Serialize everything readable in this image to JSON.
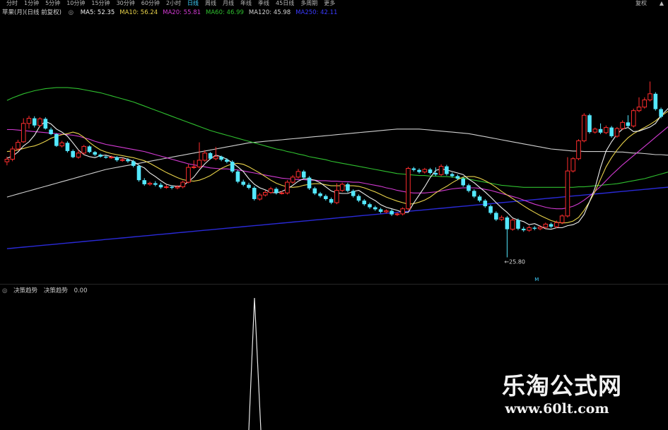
{
  "toolbar": {
    "items": [
      "分时",
      "1分钟",
      "5分钟",
      "10分钟",
      "15分钟",
      "30分钟",
      "60分钟",
      "2小时",
      "日线",
      "周线",
      "月线",
      "年线",
      "季线",
      "45日线",
      "多周期",
      "更多"
    ],
    "active_index": 8,
    "right_labels": [
      "复权",
      "▲"
    ]
  },
  "ma_legend": {
    "title": "苹果(月)(日线 前复权)",
    "items": [
      {
        "text": "MA5: 52.35",
        "color": "#f0f0f0"
      },
      {
        "text": "MA10: 56.24",
        "color": "#e8d24a"
      },
      {
        "text": "MA20: 55.81",
        "color": "#d23ad2"
      },
      {
        "text": "MA60: 46.99",
        "color": "#2fbf2f"
      },
      {
        "text": "MA120: 45.98",
        "color": "#d0d0d0"
      },
      {
        "text": "MA250: 42.11",
        "color": "#3a3aff"
      }
    ]
  },
  "indicator_legend": {
    "name": "决策趋势",
    "series": "决策趋势",
    "value": "0.00"
  },
  "chart_data": {
    "type": "candlestick",
    "y_range": [
      22,
      72
    ],
    "low_label": "←25.80",
    "date_marker": "M",
    "colors": {
      "up": "#ff2d2d",
      "down": "#54e8ff",
      "ma5": "#f0f0f0",
      "ma10": "#e8d24a",
      "ma20": "#d23ad2",
      "ma60": "#2fbf2f",
      "ma120": "#d0d0d0",
      "ma250": "#2a2ad8"
    },
    "candles": [
      [
        44.5,
        45.0,
        43.8,
        45.5
      ],
      [
        45.0,
        47.0,
        44.6,
        47.5
      ],
      [
        47.0,
        48.3,
        46.7,
        48.8
      ],
      [
        48.4,
        52.0,
        48.2,
        53.0
      ],
      [
        52.0,
        53.0,
        51.0,
        53.5
      ],
      [
        53.0,
        51.6,
        51.2,
        53.4
      ],
      [
        51.6,
        52.9,
        51.3,
        53.2
      ],
      [
        52.9,
        51.0,
        50.8,
        53.2
      ],
      [
        50.8,
        49.9,
        49.7,
        51.2
      ],
      [
        49.9,
        47.6,
        47.4,
        50.1
      ],
      [
        47.6,
        48.2,
        47.3,
        48.6
      ],
      [
        48.2,
        46.6,
        46.3,
        48.5
      ],
      [
        46.6,
        45.4,
        45.2,
        46.9
      ],
      [
        45.4,
        46.2,
        45.1,
        46.8
      ],
      [
        46.2,
        47.5,
        45.9,
        47.8
      ],
      [
        47.5,
        46.4,
        46.2,
        47.7
      ],
      [
        46.4,
        45.9,
        45.6,
        46.6
      ],
      [
        45.9,
        45.5,
        45.3,
        46.1
      ],
      [
        45.5,
        45.3,
        45.1,
        45.7
      ],
      [
        45.3,
        45.4,
        45.1,
        45.7
      ],
      [
        45.4,
        44.8,
        44.5,
        45.6
      ],
      [
        44.8,
        44.9,
        44.5,
        45.3
      ],
      [
        44.9,
        44.6,
        44.3,
        45.2
      ],
      [
        44.6,
        43.7,
        43.4,
        44.9
      ],
      [
        43.7,
        40.9,
        40.6,
        44.0
      ],
      [
        40.9,
        40.1,
        39.8,
        41.3
      ],
      [
        40.1,
        40.3,
        39.8,
        40.6
      ],
      [
        40.3,
        40.0,
        39.7,
        40.7
      ],
      [
        40.0,
        39.5,
        39.2,
        40.4
      ],
      [
        39.5,
        39.6,
        39.2,
        40.0
      ],
      [
        39.6,
        39.4,
        39.1,
        39.9
      ],
      [
        39.4,
        39.6,
        39.1,
        39.9
      ],
      [
        39.6,
        40.5,
        39.3,
        40.8
      ],
      [
        40.5,
        43.4,
        40.3,
        44.0
      ],
      [
        43.4,
        43.5,
        43.1,
        44.8
      ],
      [
        43.5,
        44.8,
        43.2,
        48.3
      ],
      [
        44.8,
        46.2,
        44.5,
        46.8
      ],
      [
        46.2,
        45.1,
        44.9,
        46.4
      ],
      [
        45.1,
        45.5,
        44.8,
        47.4
      ],
      [
        45.5,
        44.9,
        44.6,
        45.7
      ],
      [
        44.9,
        44.5,
        44.2,
        45.2
      ],
      [
        44.5,
        42.6,
        42.3,
        44.8
      ],
      [
        42.6,
        40.6,
        40.3,
        42.9
      ],
      [
        40.6,
        40.0,
        39.7,
        41.0
      ],
      [
        40.0,
        39.4,
        39.1,
        40.4
      ],
      [
        39.4,
        37.2,
        36.9,
        39.7
      ],
      [
        37.2,
        38.0,
        36.9,
        38.4
      ],
      [
        38.0,
        38.5,
        37.7,
        38.9
      ],
      [
        38.5,
        39.2,
        38.2,
        39.6
      ],
      [
        39.2,
        38.4,
        38.1,
        39.5
      ],
      [
        38.4,
        38.4,
        38.1,
        38.8
      ],
      [
        38.4,
        40.5,
        38.1,
        40.9
      ],
      [
        40.5,
        41.5,
        40.2,
        41.9
      ],
      [
        41.5,
        42.6,
        41.2,
        43.1
      ],
      [
        42.6,
        41.4,
        41.1,
        42.9
      ],
      [
        41.4,
        39.3,
        39.0,
        41.7
      ],
      [
        39.3,
        38.3,
        38.0,
        39.6
      ],
      [
        38.3,
        37.8,
        37.5,
        38.6
      ],
      [
        37.8,
        37.2,
        36.9,
        38.1
      ],
      [
        37.2,
        36.5,
        36.2,
        37.5
      ],
      [
        36.5,
        38.9,
        36.2,
        40.3
      ],
      [
        38.9,
        40.1,
        38.6,
        40.4
      ],
      [
        40.1,
        38.8,
        38.5,
        40.4
      ],
      [
        38.8,
        37.8,
        37.5,
        39.1
      ],
      [
        37.8,
        36.9,
        36.6,
        38.1
      ],
      [
        36.9,
        36.2,
        35.9,
        37.2
      ],
      [
        36.2,
        35.6,
        35.3,
        36.5
      ],
      [
        35.6,
        35.2,
        34.9,
        35.9
      ],
      [
        35.2,
        34.7,
        34.4,
        35.5
      ],
      [
        34.7,
        34.9,
        34.4,
        35.2
      ],
      [
        34.9,
        34.2,
        33.9,
        35.2
      ],
      [
        34.2,
        34.3,
        33.9,
        34.6
      ],
      [
        34.3,
        35.3,
        34.0,
        35.6
      ],
      [
        35.3,
        43.2,
        35.0,
        43.5
      ],
      [
        43.2,
        42.9,
        42.6,
        43.5
      ],
      [
        42.9,
        42.5,
        42.2,
        43.2
      ],
      [
        42.5,
        43.0,
        42.2,
        43.3
      ],
      [
        43.0,
        42.3,
        42.0,
        43.3
      ],
      [
        42.3,
        42.0,
        41.7,
        43.4
      ],
      [
        42.0,
        43.6,
        41.7,
        44.0
      ],
      [
        43.6,
        42.1,
        41.8,
        43.9
      ],
      [
        42.1,
        41.7,
        41.4,
        42.4
      ],
      [
        41.7,
        41.2,
        40.9,
        42.0
      ],
      [
        41.2,
        39.9,
        39.6,
        41.5
      ],
      [
        39.9,
        38.8,
        38.5,
        40.2
      ],
      [
        38.8,
        37.7,
        37.4,
        39.1
      ],
      [
        37.7,
        36.9,
        36.6,
        38.0
      ],
      [
        36.9,
        35.8,
        35.5,
        37.2
      ],
      [
        35.8,
        34.5,
        34.2,
        36.1
      ],
      [
        34.5,
        33.2,
        32.9,
        34.8
      ],
      [
        33.2,
        33.6,
        32.9,
        34.0
      ],
      [
        33.6,
        31.3,
        25.8,
        33.9
      ],
      [
        31.3,
        33.1,
        31.0,
        33.4
      ],
      [
        33.1,
        31.4,
        31.1,
        33.4
      ],
      [
        31.4,
        31.1,
        30.8,
        31.8
      ],
      [
        31.1,
        31.6,
        30.8,
        32.0
      ],
      [
        31.6,
        31.4,
        31.1,
        31.9
      ],
      [
        31.4,
        31.7,
        31.1,
        32.1
      ],
      [
        31.7,
        32.3,
        31.4,
        32.6
      ],
      [
        32.3,
        31.8,
        31.5,
        32.6
      ],
      [
        31.8,
        32.6,
        31.5,
        33.0
      ],
      [
        32.6,
        33.9,
        32.3,
        34.2
      ],
      [
        33.9,
        42.7,
        33.6,
        45.4
      ],
      [
        42.7,
        45.1,
        42.4,
        45.4
      ],
      [
        45.1,
        48.6,
        44.8,
        48.9
      ],
      [
        48.6,
        53.6,
        48.3,
        54.0
      ],
      [
        53.6,
        50.3,
        50.0,
        53.9
      ],
      [
        50.3,
        50.9,
        50.0,
        51.2
      ],
      [
        50.9,
        50.2,
        49.9,
        52.0
      ],
      [
        50.2,
        51.2,
        49.9,
        51.6
      ],
      [
        51.2,
        49.5,
        49.2,
        51.5
      ],
      [
        49.5,
        51.0,
        49.2,
        51.3
      ],
      [
        51.0,
        52.2,
        50.7,
        52.6
      ],
      [
        52.2,
        51.5,
        51.2,
        53.6
      ],
      [
        51.5,
        54.5,
        51.2,
        54.9
      ],
      [
        54.5,
        55.2,
        54.2,
        57.1
      ],
      [
        55.2,
        56.6,
        54.9,
        57.1
      ],
      [
        56.6,
        57.8,
        56.3,
        60.2
      ],
      [
        57.8,
        54.8,
        54.5,
        58.1
      ],
      [
        54.8,
        53.3,
        53.0,
        55.1
      ]
    ],
    "ma5": [
      45.2,
      45.6,
      46.4,
      47.6,
      48.4,
      49.7,
      51.5,
      52.4,
      51.9,
      50.9,
      50.3,
      49.5,
      48.2,
      46.8,
      45.9,
      45.5,
      45.3,
      45.7,
      45.8,
      45.5,
      45.3,
      45.3,
      45.0,
      44.6,
      43.8,
      43.3,
      42.3,
      41.6,
      40.8,
      40.1,
      39.8,
      39.7,
      39.8,
      40.6,
      41.5,
      42.9,
      44.1,
      45.1,
      45.8,
      45.5,
      45.0,
      44.3,
      43.5,
      42.6,
      41.2,
      40.1,
      39.4,
      39.0,
      38.5,
      38.4,
      38.7,
      39.2,
      39.9,
      40.7,
      41.2,
      41.1,
      40.9,
      40.4,
      39.6,
      38.8,
      38.4,
      38.3,
      38.3,
      38.7,
      38.9,
      38.2,
      37.5,
      36.9,
      36.1,
      35.6,
      35.3,
      35.0,
      34.6,
      34.6,
      36.4,
      38.0,
      39.6,
      41.4,
      42.8,
      43.1,
      42.9,
      42.6,
      42.3,
      42.0,
      41.1,
      40.4,
      39.5,
      38.6,
      37.6,
      36.5,
      35.5,
      34.6,
      33.5,
      33.1,
      32.8,
      32.2,
      32.4,
      31.9,
      31.4,
      31.3,
      31.6,
      31.6,
      32.0,
      32.2,
      32.7,
      34.2,
      36.7,
      39.4,
      43.4,
      46.6,
      48.4,
      49.9,
      50.9,
      51.2,
      50.4,
      50.5,
      50.9,
      51.3,
      52.0,
      53.5,
      54.6,
      55.7,
      55.8,
      55.6
    ],
    "ma10": [
      46.5,
      46.6,
      46.8,
      47.1,
      47.4,
      47.6,
      48.0,
      48.5,
      49.1,
      49.5,
      49.8,
      50.0,
      50.3,
      50.0,
      49.3,
      48.3,
      47.5,
      46.8,
      46.4,
      46.1,
      45.9,
      45.7,
      45.5,
      45.3,
      45.0,
      44.7,
      44.2,
      43.6,
      43.0,
      42.4,
      41.9,
      41.4,
      41.0,
      40.8,
      40.7,
      40.9,
      41.3,
      41.8,
      42.5,
      43.2,
      43.7,
      44.1,
      44.2,
      44.0,
      43.5,
      42.9,
      42.3,
      41.6,
      40.9,
      40.3,
      39.9,
      39.6,
      39.5,
      39.6,
      39.9,
      40.1,
      40.2,
      40.2,
      40.0,
      39.8,
      39.8,
      39.8,
      39.8,
      39.8,
      39.7,
      39.4,
      39.0,
      38.6,
      38.1,
      37.6,
      37.2,
      36.8,
      36.5,
      36.2,
      36.3,
      36.6,
      37.0,
      37.6,
      38.4,
      39.1,
      39.7,
      40.4,
      41.0,
      41.5,
      41.6,
      41.6,
      41.3,
      40.8,
      40.2,
      39.5,
      38.7,
      38.0,
      37.3,
      36.6,
      35.9,
      35.2,
      34.6,
      34.0,
      33.5,
      33.0,
      32.7,
      32.5,
      32.6,
      32.9,
      33.6,
      35.0,
      36.7,
      38.7,
      41.1,
      43.5,
      45.3,
      46.8,
      48.1,
      49.2,
      50.0,
      50.6,
      51.2,
      51.8,
      52.5,
      53.4,
      54.2,
      54.8,
      55.2,
      55.5
    ],
    "ma20": [
      50.8,
      50.8,
      50.7,
      50.6,
      50.5,
      50.4,
      50.3,
      50.2,
      50.1,
      50.0,
      49.9,
      49.8,
      49.7,
      49.5,
      49.2,
      48.9,
      48.5,
      48.2,
      47.9,
      47.7,
      47.5,
      47.3,
      47.1,
      46.9,
      46.7,
      46.5,
      46.2,
      45.9,
      45.6,
      45.3,
      45.0,
      44.7,
      44.4,
      44.1,
      43.9,
      43.7,
      43.5,
      43.3,
      43.2,
      43.1,
      43.1,
      43.0,
      42.9,
      42.7,
      42.5,
      42.3,
      42.1,
      41.9,
      41.7,
      41.5,
      41.3,
      41.2,
      41.1,
      41.0,
      41.0,
      40.9,
      40.9,
      40.8,
      40.8,
      40.7,
      40.7,
      40.6,
      40.6,
      40.5,
      40.5,
      40.3,
      40.1,
      39.9,
      39.7,
      39.4,
      39.2,
      38.9,
      38.7,
      38.5,
      38.4,
      38.4,
      38.4,
      38.5,
      38.6,
      38.8,
      39.0,
      39.2,
      39.3,
      39.4,
      39.4,
      39.4,
      39.3,
      39.1,
      38.9,
      38.6,
      38.3,
      38.0,
      37.7,
      37.4,
      37.0,
      36.6,
      36.2,
      35.9,
      35.6,
      35.4,
      35.3,
      35.3,
      35.5,
      35.8,
      36.3,
      37.0,
      37.8,
      38.7,
      39.7,
      40.8,
      41.9,
      42.9,
      43.9,
      44.8,
      45.7,
      46.6,
      47.5,
      48.4,
      49.3,
      50.2,
      51.1,
      52.0,
      52.8,
      53.6
    ],
    "ma60": [
      56.5,
      57.0,
      57.4,
      57.8,
      58.1,
      58.4,
      58.6,
      58.8,
      58.9,
      59.0,
      59.0,
      59.0,
      58.9,
      58.8,
      58.6,
      58.4,
      58.2,
      58.0,
      57.7,
      57.4,
      57.1,
      56.8,
      56.5,
      56.2,
      55.8,
      55.4,
      55.0,
      54.6,
      54.2,
      53.8,
      53.4,
      53.0,
      52.6,
      52.2,
      51.8,
      51.4,
      51.0,
      50.6,
      50.3,
      50.0,
      49.7,
      49.4,
      49.1,
      48.8,
      48.5,
      48.2,
      47.9,
      47.6,
      47.3,
      47.0,
      46.8,
      46.5,
      46.3,
      46.0,
      45.8,
      45.5,
      45.3,
      45.1,
      44.9,
      44.6,
      44.4,
      44.2,
      44.0,
      43.8,
      43.6,
      43.4,
      43.2,
      43.0,
      42.8,
      42.6,
      42.4,
      42.2,
      42.1,
      42.0,
      41.9,
      41.8,
      41.8,
      41.7,
      41.7,
      41.6,
      41.6,
      41.5,
      41.4,
      41.3,
      41.1,
      40.9,
      40.7,
      40.5,
      40.3,
      40.1,
      39.9,
      39.8,
      39.7,
      39.6,
      39.5,
      39.5,
      39.5,
      39.5,
      39.5,
      39.5,
      39.5,
      39.5,
      39.5,
      39.5,
      39.6,
      39.6,
      39.7,
      39.8,
      39.9,
      40.0,
      40.1,
      40.2,
      40.4,
      40.6,
      40.8,
      41.0,
      41.2,
      41.5,
      41.8,
      42.1,
      42.4,
      42.7,
      43.0,
      43.3
    ],
    "ma120": [
      37.6,
      37.9,
      38.2,
      38.5,
      38.8,
      39.1,
      39.4,
      39.7,
      40.0,
      40.3,
      40.6,
      40.9,
      41.2,
      41.5,
      41.8,
      42.1,
      42.4,
      42.7,
      43.0,
      43.2,
      43.4,
      43.6,
      43.8,
      44.0,
      44.2,
      44.4,
      44.6,
      44.8,
      45.0,
      45.2,
      45.4,
      45.6,
      45.8,
      46.0,
      46.2,
      46.4,
      46.6,
      46.8,
      47.0,
      47.2,
      47.4,
      47.6,
      47.8,
      48.0,
      48.2,
      48.3,
      48.4,
      48.5,
      48.6,
      48.7,
      48.8,
      48.9,
      49.0,
      49.1,
      49.2,
      49.3,
      49.4,
      49.5,
      49.6,
      49.7,
      49.8,
      49.9,
      50.0,
      50.1,
      50.2,
      50.3,
      50.4,
      50.5,
      50.6,
      50.7,
      50.8,
      50.9,
      50.9,
      50.9,
      50.9,
      50.9,
      50.8,
      50.7,
      50.6,
      50.5,
      50.4,
      50.3,
      50.2,
      50.1,
      50.0,
      49.8,
      49.6,
      49.4,
      49.2,
      49.0,
      48.8,
      48.6,
      48.4,
      48.2,
      48.0,
      47.8,
      47.6,
      47.4,
      47.2,
      47.0,
      46.9,
      46.8,
      46.7,
      46.6,
      46.6,
      46.5,
      46.5,
      46.5,
      46.5,
      46.5,
      46.5,
      46.4,
      46.4,
      46.3,
      46.2,
      46.2,
      46.1,
      46.0,
      45.9,
      45.9,
      45.8,
      45.8,
      45.7,
      45.7
    ],
    "ma250": [
      27.5,
      27.6,
      27.7,
      27.8,
      27.9,
      28.0,
      28.1,
      28.2,
      28.3,
      28.4,
      28.5,
      28.6,
      28.7,
      28.8,
      28.9,
      29.0,
      29.1,
      29.2,
      29.3,
      29.4,
      29.5,
      29.6,
      29.7,
      29.8,
      29.9,
      30.0,
      30.1,
      30.2,
      30.3,
      30.4,
      30.5,
      30.6,
      30.7,
      30.8,
      30.9,
      31.0,
      31.1,
      31.2,
      31.3,
      31.4,
      31.5,
      31.6,
      31.7,
      31.8,
      31.9,
      32.0,
      32.1,
      32.2,
      32.3,
      32.4,
      32.5,
      32.6,
      32.7,
      32.8,
      32.9,
      33.0,
      33.1,
      33.2,
      33.3,
      33.4,
      33.5,
      33.6,
      33.7,
      33.8,
      33.9,
      34.0,
      34.1,
      34.2,
      34.3,
      34.4,
      34.5,
      34.6,
      34.7,
      34.8,
      34.9,
      35.0,
      35.1,
      35.2,
      35.3,
      35.4,
      35.5,
      35.6,
      35.7,
      35.8,
      35.9,
      36.0,
      36.1,
      36.2,
      36.3,
      36.4,
      36.5,
      36.6,
      36.7,
      36.8,
      36.9,
      37.0,
      37.1,
      37.2,
      37.3,
      37.4,
      37.5,
      37.6,
      37.7,
      37.8,
      37.9,
      38.0,
      38.1,
      38.2,
      38.3,
      38.4,
      38.5,
      38.6,
      38.7,
      38.8,
      38.9,
      39.0,
      39.1,
      39.2,
      39.3,
      39.4,
      39.5,
      39.6,
      39.7,
      39.8,
      39.9,
      40.0
    ]
  },
  "indicator": {
    "y_range": [
      0,
      1
    ],
    "spike_index": 45,
    "spike_value": 1
  },
  "watermark": {
    "title": "乐淘公式网",
    "url": "www.60lt.com"
  }
}
